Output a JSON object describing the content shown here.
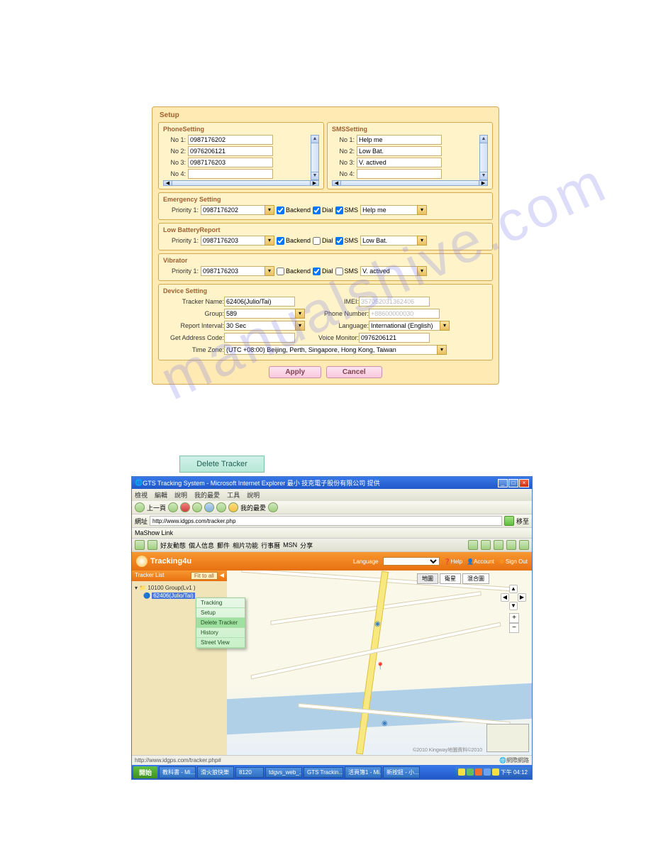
{
  "watermark": "manualshive.com",
  "setup": {
    "title": "Setup",
    "phone": {
      "title": "PhoneSetting",
      "labels": {
        "no1": "No 1:",
        "no2": "No 2:",
        "no3": "No 3:",
        "no4": "No 4:"
      },
      "values": {
        "no1": "0987176202",
        "no2": "0976206121",
        "no3": "0987176203",
        "no4": ""
      }
    },
    "sms": {
      "title": "SMSSetting",
      "labels": {
        "no1": "No 1:",
        "no2": "No 2:",
        "no3": "No 3:",
        "no4": "No 4:"
      },
      "values": {
        "no1": "Help me",
        "no2": "Low Bat.",
        "no3": "V. actived",
        "no4": ""
      }
    },
    "emergency": {
      "title": "Emergency Setting",
      "priority_label": "Priority 1:",
      "priority_value": "0987176202",
      "backend_label": "Backend",
      "backend": true,
      "dial_label": "Dial",
      "dial": true,
      "sms_label": "SMS",
      "sms": true,
      "msg": "Help me"
    },
    "lowbat": {
      "title": "Low BatteryReport",
      "priority_label": "Priority 1:",
      "priority_value": "0987176203",
      "backend_label": "Backend",
      "backend": true,
      "dial_label": "Dial",
      "dial": false,
      "sms_label": "SMS",
      "sms": true,
      "msg": "Low Bat."
    },
    "vibrator": {
      "title": "Vibrator",
      "priority_label": "Priority 1:",
      "priority_value": "0987176203",
      "backend_label": "Backend",
      "backend": false,
      "dial_label": "Dial",
      "dial": true,
      "sms_label": "SMS",
      "sms": false,
      "msg": "V. actived"
    },
    "device": {
      "title": "Device Setting",
      "tracker_name_label": "Tracker Name:",
      "tracker_name": "62406(Julio/Tai)",
      "imei_label": "IMEI:",
      "imei": "357052031362406",
      "group_label": "Group:",
      "group": "589",
      "phone_label": "Phone Number:",
      "phone": "+88600000030",
      "interval_label": "Report Interval:",
      "interval": "30 Sec",
      "language_label": "Language:",
      "language": "International (English)",
      "addr_label": "Get Address Code:",
      "addr": "",
      "voice_label": "Voice Monitor:",
      "voice": "0976206121",
      "tz_label": "Time Zone:",
      "tz": "(UTC +08:00) Beijing, Perth, Singapore, Hong Kong, Taiwan"
    },
    "apply": "Apply",
    "cancel": "Cancel"
  },
  "delete_tracker": "Delete Tracker",
  "browser": {
    "title": "GTS Tracking System - Microsoft Internet Explorer 最小 技克電子股份有限公司 提供",
    "menus": {
      "m1": "檢視",
      "m2": "編輯",
      "m3": "說明",
      "m4": "我的最愛",
      "m5": "工具",
      "m6": "說明"
    },
    "nav_back": "上一頁",
    "fav": "我的最愛",
    "addr_label": "網址",
    "address": "http://www.idgps.com/tracker.php",
    "go": "移至",
    "links": "MaShow Link",
    "tabs": {
      "t1": "好友動態",
      "t2": "個人信息",
      "t3": "郵件",
      "t4": "相片功能",
      "t5": "行事曆",
      "t6": "MSN",
      "t7": "分享"
    },
    "status": "http://www.idgps.com/tracker.php#",
    "status_right": "網際網路"
  },
  "app": {
    "brand": "Tracking4u",
    "lang_label": "Language",
    "help": "Help",
    "account": "Account",
    "signout": "Sign Out",
    "sidebar_title": "Tracker List",
    "fit_all": "Fit to all",
    "tree_root": "10100 Group(Lv1 )",
    "tree_item": "62406(Julio/Tai)",
    "ctx": {
      "c1": "Tracking",
      "c2": "Setup",
      "c3": "Delete Tracker",
      "c4": "History",
      "c5": "Street View"
    },
    "map_buttons": {
      "b1": "地圖",
      "b2": "衛星",
      "b3": "混合圖"
    },
    "map_attr": "©2010 Kingway地圖資料©2010"
  },
  "taskbar": {
    "start": "開始",
    "tasks": {
      "t1": "教科書 - Mi...",
      "t2": "滑火狼快樂",
      "t3": "8120",
      "t4": "tdgvs_web_...",
      "t5": "GTS Trackin...",
      "t6": "活頁簿1 - Mi...",
      "t7": "新按鈕 - 小..."
    },
    "clock": "下午 04:12"
  }
}
